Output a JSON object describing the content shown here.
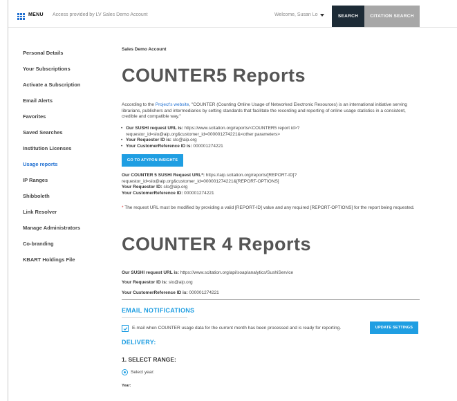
{
  "header": {
    "menu_label": "MENU",
    "access_text": "Access provided by LV Sales Demo Account",
    "welcome_text": "Welcome, Susan Lo",
    "search_label": "SEARCH",
    "citation_search_label": "CITATION SEARCH"
  },
  "sidebar": {
    "items": [
      {
        "label": "Personal Details"
      },
      {
        "label": "Your Subscriptions"
      },
      {
        "label": "Activate a Subscription"
      },
      {
        "label": "Email Alerts"
      },
      {
        "label": "Favorites"
      },
      {
        "label": "Saved Searches"
      },
      {
        "label": "Institution Licenses"
      },
      {
        "label": "Usage reports"
      },
      {
        "label": "IP Ranges"
      },
      {
        "label": "Shibboleth"
      },
      {
        "label": "Link Resolver"
      },
      {
        "label": "Manage Administrators"
      },
      {
        "label": "Co-branding"
      },
      {
        "label": "KBART Holdings File"
      }
    ],
    "active_index": 7
  },
  "main": {
    "account_name": "Sales Demo Account",
    "counter5": {
      "title": "COUNTER5 Reports",
      "intro_prefix": "According to the ",
      "intro_link": "Project's website",
      "intro_rest": ", \"COUNTER (Counting Online Usage of Networked Electronic Resources) is an international initiative serving librarians, publishers and intermediaries by setting standards that facilitate the recording and reporting of online usage statistics in a consistent, credible and compatible way.\"",
      "bullet1_label": "Our SUSHI request URL is:",
      "bullet1_value": " https://www.scitation.org/reports/<COUNTER5 report id>?requestor_id=slo@aip.org&customer_id=000001274221&<other parameters>",
      "bullet2_label": "Your Requestor ID is:",
      "bullet2_value": " slo@aip.org",
      "bullet3_label": "Your CustomerReference ID is:",
      "bullet3_value": " 000001274221",
      "atypon_button": "GO TO ATYPON INSIGHTS",
      "sushi_label": "Our COUNTER 5 SUSHI Request URL*:",
      "sushi_value": " https://aip.scitation.org/reports/[REPORT-ID]?requestor_id=slo@aip.org&customer_id=000001274221&[REPORT-OPTIONS]",
      "req_label": "Your Requestor ID:",
      "req_value": " slo@aip.org",
      "cust_label": "Your CustomerReference ID:",
      "cust_value": " 000001274221",
      "note_star": "*",
      "note_text": " The request URL must be modified by providing a valid [REPORT-ID] value and any required [REPORT-OPTIONS] for the report being requested."
    },
    "counter4": {
      "title": "COUNTER 4 Reports",
      "sushi_label": "Our SUSHI request URL is:",
      "sushi_value": " https://www.scitation.org/api/soap/analytics/SushiService",
      "req_label": "Your Requestor ID is:",
      "req_value": " slo@aip.org",
      "cust_label": "Your CustomerReference ID is:",
      "cust_value": " 000001274221"
    },
    "email_notifications": {
      "heading": "EMAIL NOTIFICATIONS",
      "checkbox_label": "E-mail when COUNTER usage data for the current month has been processed and is ready for reporting.",
      "checked": true,
      "update_button": "UPDATE SETTINGS"
    },
    "delivery": {
      "heading": "DELIVERY:",
      "select_range": "1. SELECT RANGE:",
      "radio_label": "Select year:",
      "year_label": "Year:"
    }
  },
  "colors": {
    "accent": "#1f9ee2",
    "link": "#1f6fd1",
    "search_bg": "#1d2b36",
    "citation_bg": "#a7a7a7"
  }
}
